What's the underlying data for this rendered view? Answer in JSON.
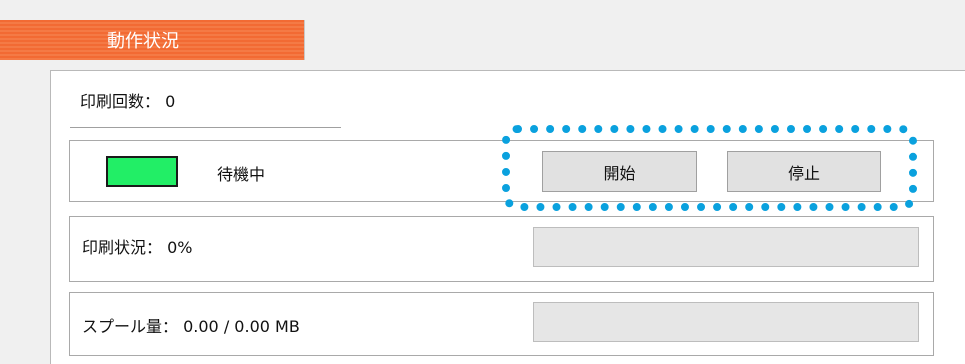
{
  "section": {
    "title": "動作状況"
  },
  "print_count": {
    "label": "印刷回数：",
    "value": "0"
  },
  "status": {
    "indicator_color": "#22ee66",
    "text": "待機中"
  },
  "buttons": {
    "start": "開始",
    "stop": "停止"
  },
  "progress": {
    "label": "印刷状況：",
    "value": "0%",
    "fraction": 0
  },
  "spool": {
    "label": "スプール量：",
    "value": "0.00 / 0.00 MB",
    "fraction": 0
  },
  "colors": {
    "tab": "#f26a33",
    "highlight": "#0aa1de",
    "indicator": "#22ee66"
  }
}
